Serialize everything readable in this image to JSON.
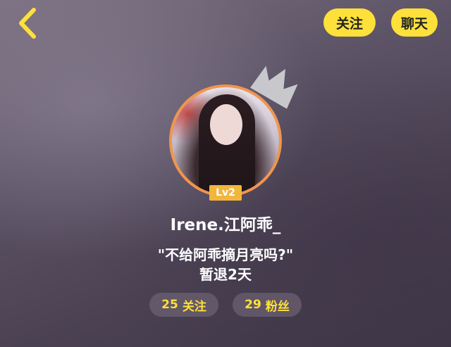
{
  "header": {
    "follow_label": "关注",
    "chat_label": "聊天"
  },
  "profile": {
    "level": "Lv2",
    "username": "Irene.江阿乖_",
    "bio": "\"不给阿乖摘月亮吗?\"",
    "status": "暂退2天"
  },
  "stats": {
    "following_count": "25",
    "following_label": "关注",
    "fans_count": "29",
    "fans_label": "粉丝"
  },
  "colors": {
    "accent_yellow": "#fde03a",
    "ring_orange": "#f0954f",
    "level_badge": "#f3b63c"
  }
}
